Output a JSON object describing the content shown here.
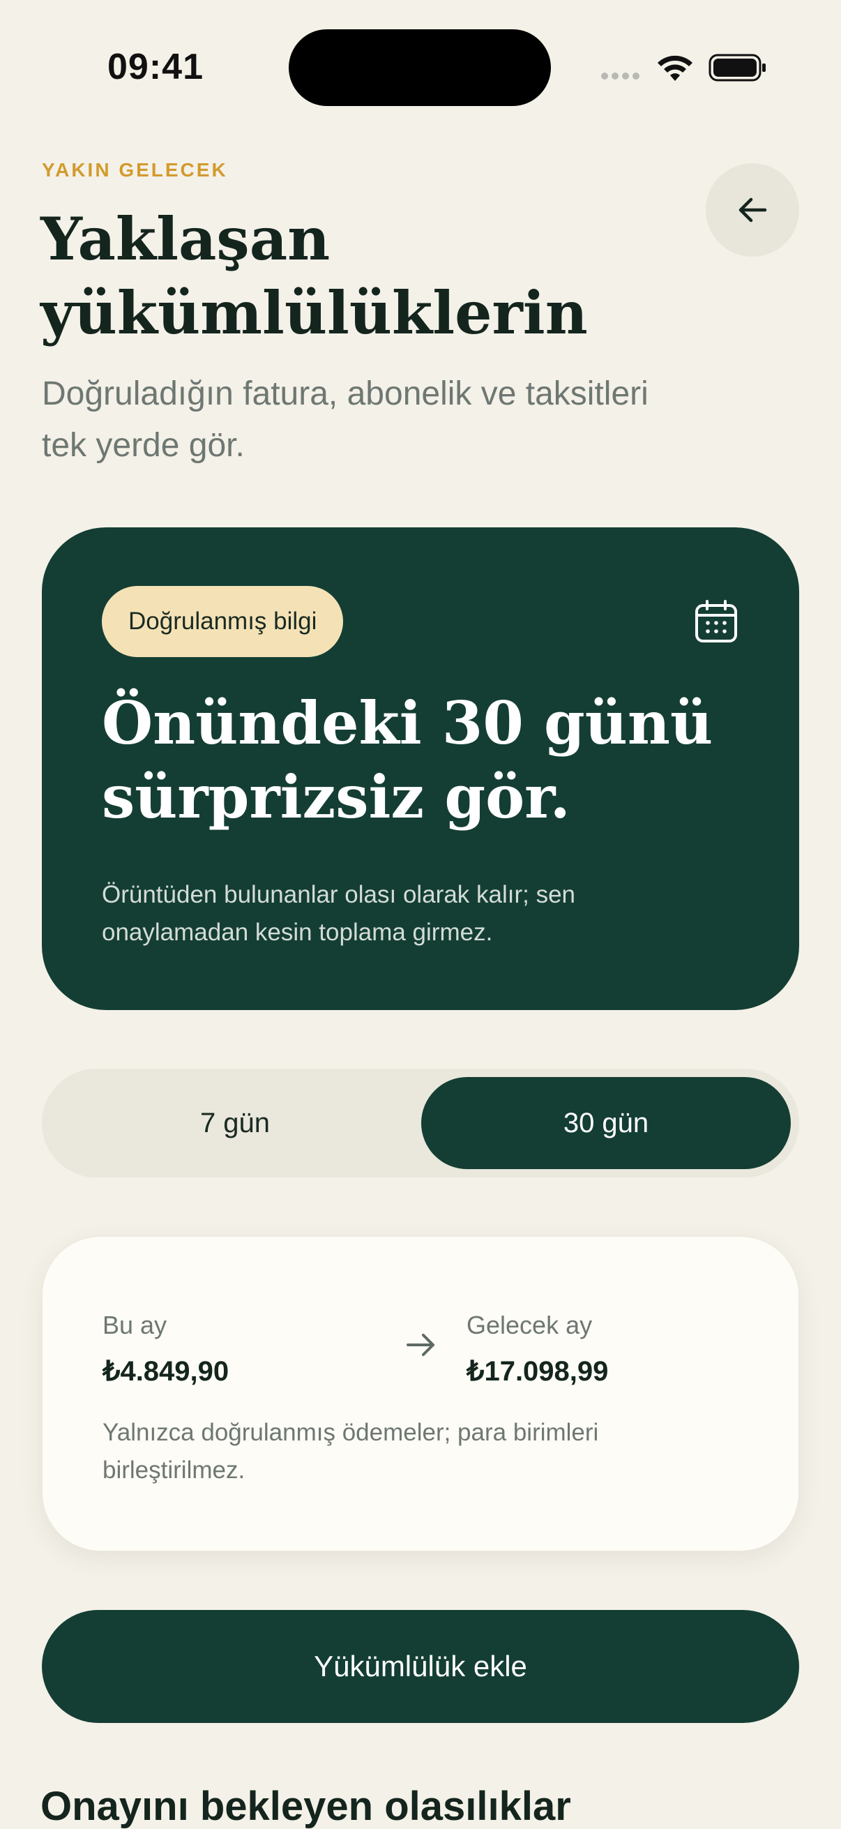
{
  "status_bar": {
    "time": "09:41"
  },
  "header": {
    "eyebrow": "YAKIN GELECEK",
    "title_line1": "Yaklaşan",
    "title_line2": "yükümlülüklerin",
    "subtitle_line1": "Doğruladığın fatura, abonelik ve taksitleri",
    "subtitle_line2": "tek yerde gör."
  },
  "hero": {
    "badge": "Doğrulanmış bilgi",
    "title_line1": "Önündeki 30 günü",
    "title_line2": "sürprizsiz gör.",
    "note_line1": "Örüntüden bulunanlar olası olarak kalır; sen",
    "note_line2": "onaylamadan kesin toplama girmez."
  },
  "range_toggle": {
    "options": [
      "7 gün",
      "30 gün"
    ],
    "selected": "30 gün"
  },
  "summary": {
    "this_month_label": "Bu ay",
    "this_month_value": "₺4.849,90",
    "next_month_label": "Gelecek ay",
    "next_month_value": "₺17.098,99",
    "note_line1": "Yalnızca doğrulanmış ödemeler; para birimleri",
    "note_line2": "birleştirilmez."
  },
  "primary_action": {
    "label": "Yükümlülük ekle"
  },
  "section": {
    "title": "Onayını bekleyen olasılıklar"
  },
  "icons": {
    "back": "arrow-left-icon",
    "calendar": "calendar-icon",
    "compare": "arrow-right-icon"
  },
  "colors": {
    "background": "#F4F1E8",
    "primary": "#143E34",
    "accent": "#D29B2E",
    "badge": "#F4E2B6"
  }
}
